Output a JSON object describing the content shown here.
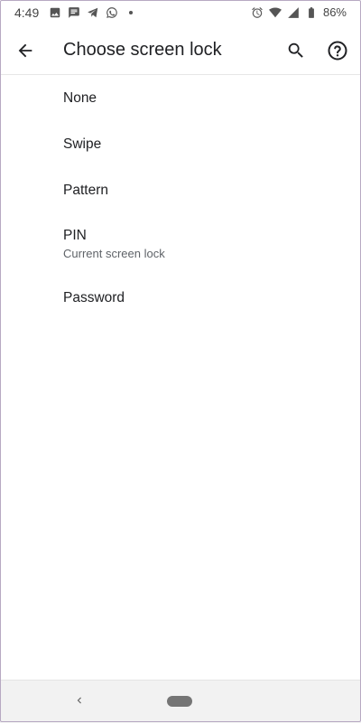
{
  "status_bar": {
    "time": "4:49",
    "battery": "86%",
    "icons": [
      "image-icon",
      "message-icon",
      "telegram-icon",
      "whatsapp-icon",
      "dot-icon",
      "alarm-icon",
      "wifi-icon",
      "signal-icon",
      "battery-icon"
    ]
  },
  "app_bar": {
    "title": "Choose screen lock",
    "back_icon": "arrow-back-icon",
    "search_icon": "search-icon",
    "help_icon": "help-icon"
  },
  "options": [
    {
      "title": "None"
    },
    {
      "title": "Swipe"
    },
    {
      "title": "Pattern"
    },
    {
      "title": "PIN",
      "subtitle": "Current screen lock"
    },
    {
      "title": "Password"
    }
  ],
  "nav_bar": {
    "back_icon": "nav-back-icon",
    "home_icon": "home-pill-icon"
  },
  "colors": {
    "text_primary": "#202124",
    "text_secondary": "#5f6368",
    "nav_bg": "#f2f2f2"
  }
}
